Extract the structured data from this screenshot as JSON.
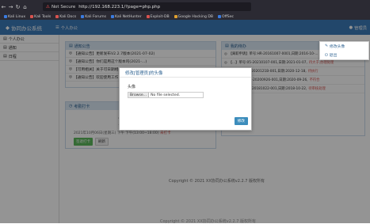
{
  "browser": {
    "url_status": "Not Secure",
    "url": "http://192.168.223.1/?page=php.php",
    "bookmarks": [
      "Kali Linux",
      "Kali Tools",
      "Kali Docs",
      "Kali Forums",
      "Kali NetHunter",
      "Exploit-DB",
      "Google Hacking DB",
      "OffSec"
    ]
  },
  "header": {
    "logo": "协同办公系统",
    "tab": "个人办公",
    "user": "管理员"
  },
  "sidebar": {
    "items": [
      {
        "label": "个人办公"
      },
      {
        "label": "通知"
      },
      {
        "label": "日程"
      }
    ]
  },
  "notice_panel": {
    "title": "通知公告",
    "items": [
      "【通知公告】更新发布V2.2.7版本(2021-07-02)",
      "【通知公告】你们是用这个版本吗(2021-...)",
      "【可用相关】关于可日期相关 ...",
      "【通知公告】欢迎使用工作 ..."
    ]
  },
  "todo_panel": {
    "title": "我的待办",
    "items": [
      {
        "text": "【离职申请】单号:HR-20161007-0001,日期:2016-10-...",
        "status": ""
      },
      {
        "text": "【...】单号:05-20210107-001,日期:2021-01-07,",
        "status": "待大于,办理处理"
      },
      {
        "text": "【...】单号:W-2020121B-001,日期:2020-12-18,",
        "status": "待执行"
      },
      {
        "text": "【...】单号:OA-20200926-001,日期:2020-09-26,",
        "status": "不符合"
      },
      {
        "text": "【...】单号:FF-20181022-001,日期:2018-10-22,",
        "status": "待审核处理"
      }
    ]
  },
  "checkin_panel": {
    "title": "考勤打卡",
    "time": "17:26:43",
    "date_line": "2021年10月06日(星期三) 下午",
    "range_line": "下午(13:00~18:00)",
    "status": "未打卡",
    "btn_checkin": "签退打卡",
    "btn_refresh": "刷新"
  },
  "footer": {
    "copyright": "Copyright © 2021    XX协同办公系统v2.2.7  版权所有",
    "copyright2": "Copyright © 2021    XX协同办公系统v2.2.7  版权所有"
  },
  "modal": {
    "title": "修改[管理员]的头像",
    "label": "头像",
    "browse": "Browse...",
    "file_status": "No file selected.",
    "ok": "修改"
  },
  "dropdown": {
    "items": [
      "修改头像",
      "退出"
    ]
  },
  "colors": {
    "header": "#3c7ab8",
    "panel_head": "#dbe8f5",
    "accent": "#3c8dbc",
    "overlay": "rgba(0,0,0,0.42)"
  }
}
